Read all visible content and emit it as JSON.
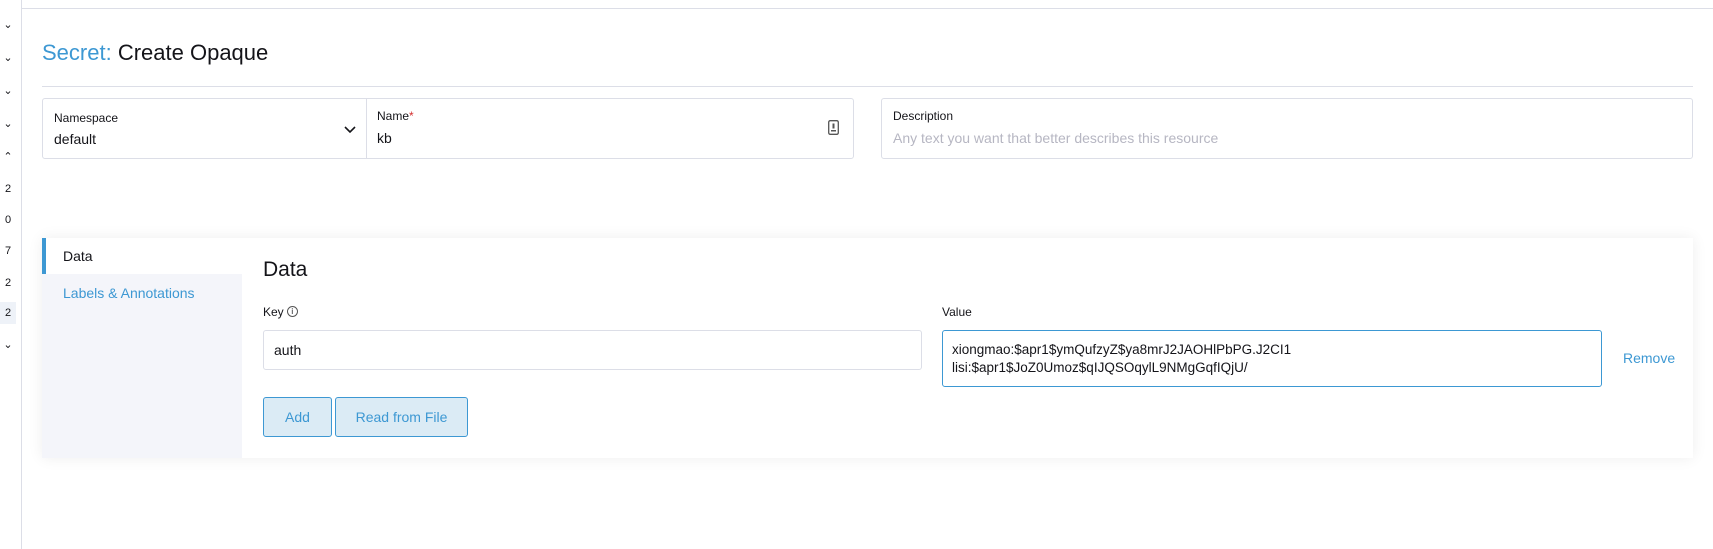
{
  "gutter": {
    "items": [
      "⌄",
      "⌄",
      "⌄",
      "⌄",
      "⌃",
      "2",
      "0",
      "7",
      "2",
      "2",
      "⌄"
    ]
  },
  "header": {
    "kind": "Secret:",
    "action": "Create Opaque"
  },
  "form": {
    "namespace": {
      "label": "Namespace",
      "value": "default"
    },
    "name": {
      "label": "Name",
      "required_mark": "*",
      "value": "kb"
    },
    "description": {
      "label": "Description",
      "placeholder": "Any text you want that better describes this resource"
    }
  },
  "tabs": [
    {
      "label": "Data",
      "active": true
    },
    {
      "label": "Labels & Annotations",
      "active": false
    }
  ],
  "data_section": {
    "title": "Data",
    "key_label": "Key",
    "value_label": "Value",
    "rows": [
      {
        "key": "auth",
        "value": "xiongmao:$apr1$ymQufzyZ$ya8mrJ2JAOHlPbPG.J2CI1\nlisi:$apr1$JoZ0Umoz$qIJQSOqylL9NMgGqfIQjU/",
        "remove_label": "Remove"
      }
    ],
    "add_label": "Add",
    "read_file_label": "Read from File"
  },
  "colors": {
    "accent": "#3d98d3",
    "border": "#dcdee7",
    "tab_bg": "#f4f5fa",
    "required": "#d32f2f"
  }
}
